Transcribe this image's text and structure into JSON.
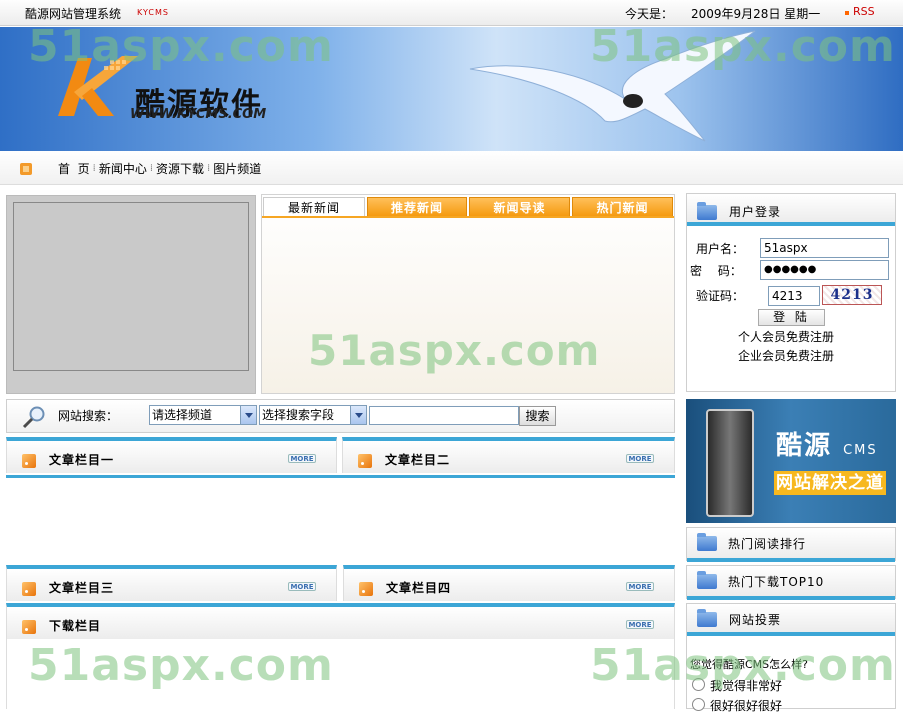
{
  "topbar": {
    "title": "酷源网站管理系统",
    "brand_small": "KYCMS",
    "today_label": "今天是：",
    "date": "2009年9月28日  星期一",
    "rss": "RSS"
  },
  "banner": {
    "logo_text": "酷源软件",
    "logo_url": "WWW.KYCMS.COM",
    "watermark": "51aspx.com"
  },
  "nav": {
    "items": [
      "首  页",
      "新闻中心",
      "资源下载",
      "图片频道"
    ],
    "separator": "⁞"
  },
  "news": {
    "tabs": [
      "最新新闻",
      "推荐新闻",
      "新闻导读",
      "热门新闻"
    ]
  },
  "search": {
    "label": "网站搜索：",
    "channel_select": "请选择频道",
    "field_select": "选择搜索字段",
    "input_value": "",
    "button": "搜索"
  },
  "sections": {
    "col1": "文章栏目一",
    "col2": "文章栏目二",
    "col3": "文章栏目三",
    "col4": "文章栏目四",
    "download": "下载栏目",
    "more": "MORE"
  },
  "login": {
    "title": "用户登录",
    "username_label": "用户名：",
    "username_value": "51aspx",
    "password_label": "密　 码：",
    "password_value": "●●●●●●",
    "captcha_label": "验证码：",
    "captcha_input": "4213",
    "captcha_image_text": "4213",
    "button": "登 陆",
    "register_personal": "个人会员免费注册",
    "register_company": "企业会员免费注册"
  },
  "ad": {
    "line1": "酷源",
    "line1_small": "CMS",
    "line2": "网站解决之道"
  },
  "right_panels": {
    "hot_read": "热门阅读排行",
    "hot_download": "热门下载TOP10",
    "vote": "网站投票",
    "vote_question": "您觉得酷源CMS怎么样?",
    "vote_option1": "我觉得非常好",
    "vote_option2": "很好很好很好"
  },
  "colors": {
    "accent_blue": "#3ca6d6",
    "tab_orange": "#f59a10",
    "rss_red": "#cc0000"
  }
}
